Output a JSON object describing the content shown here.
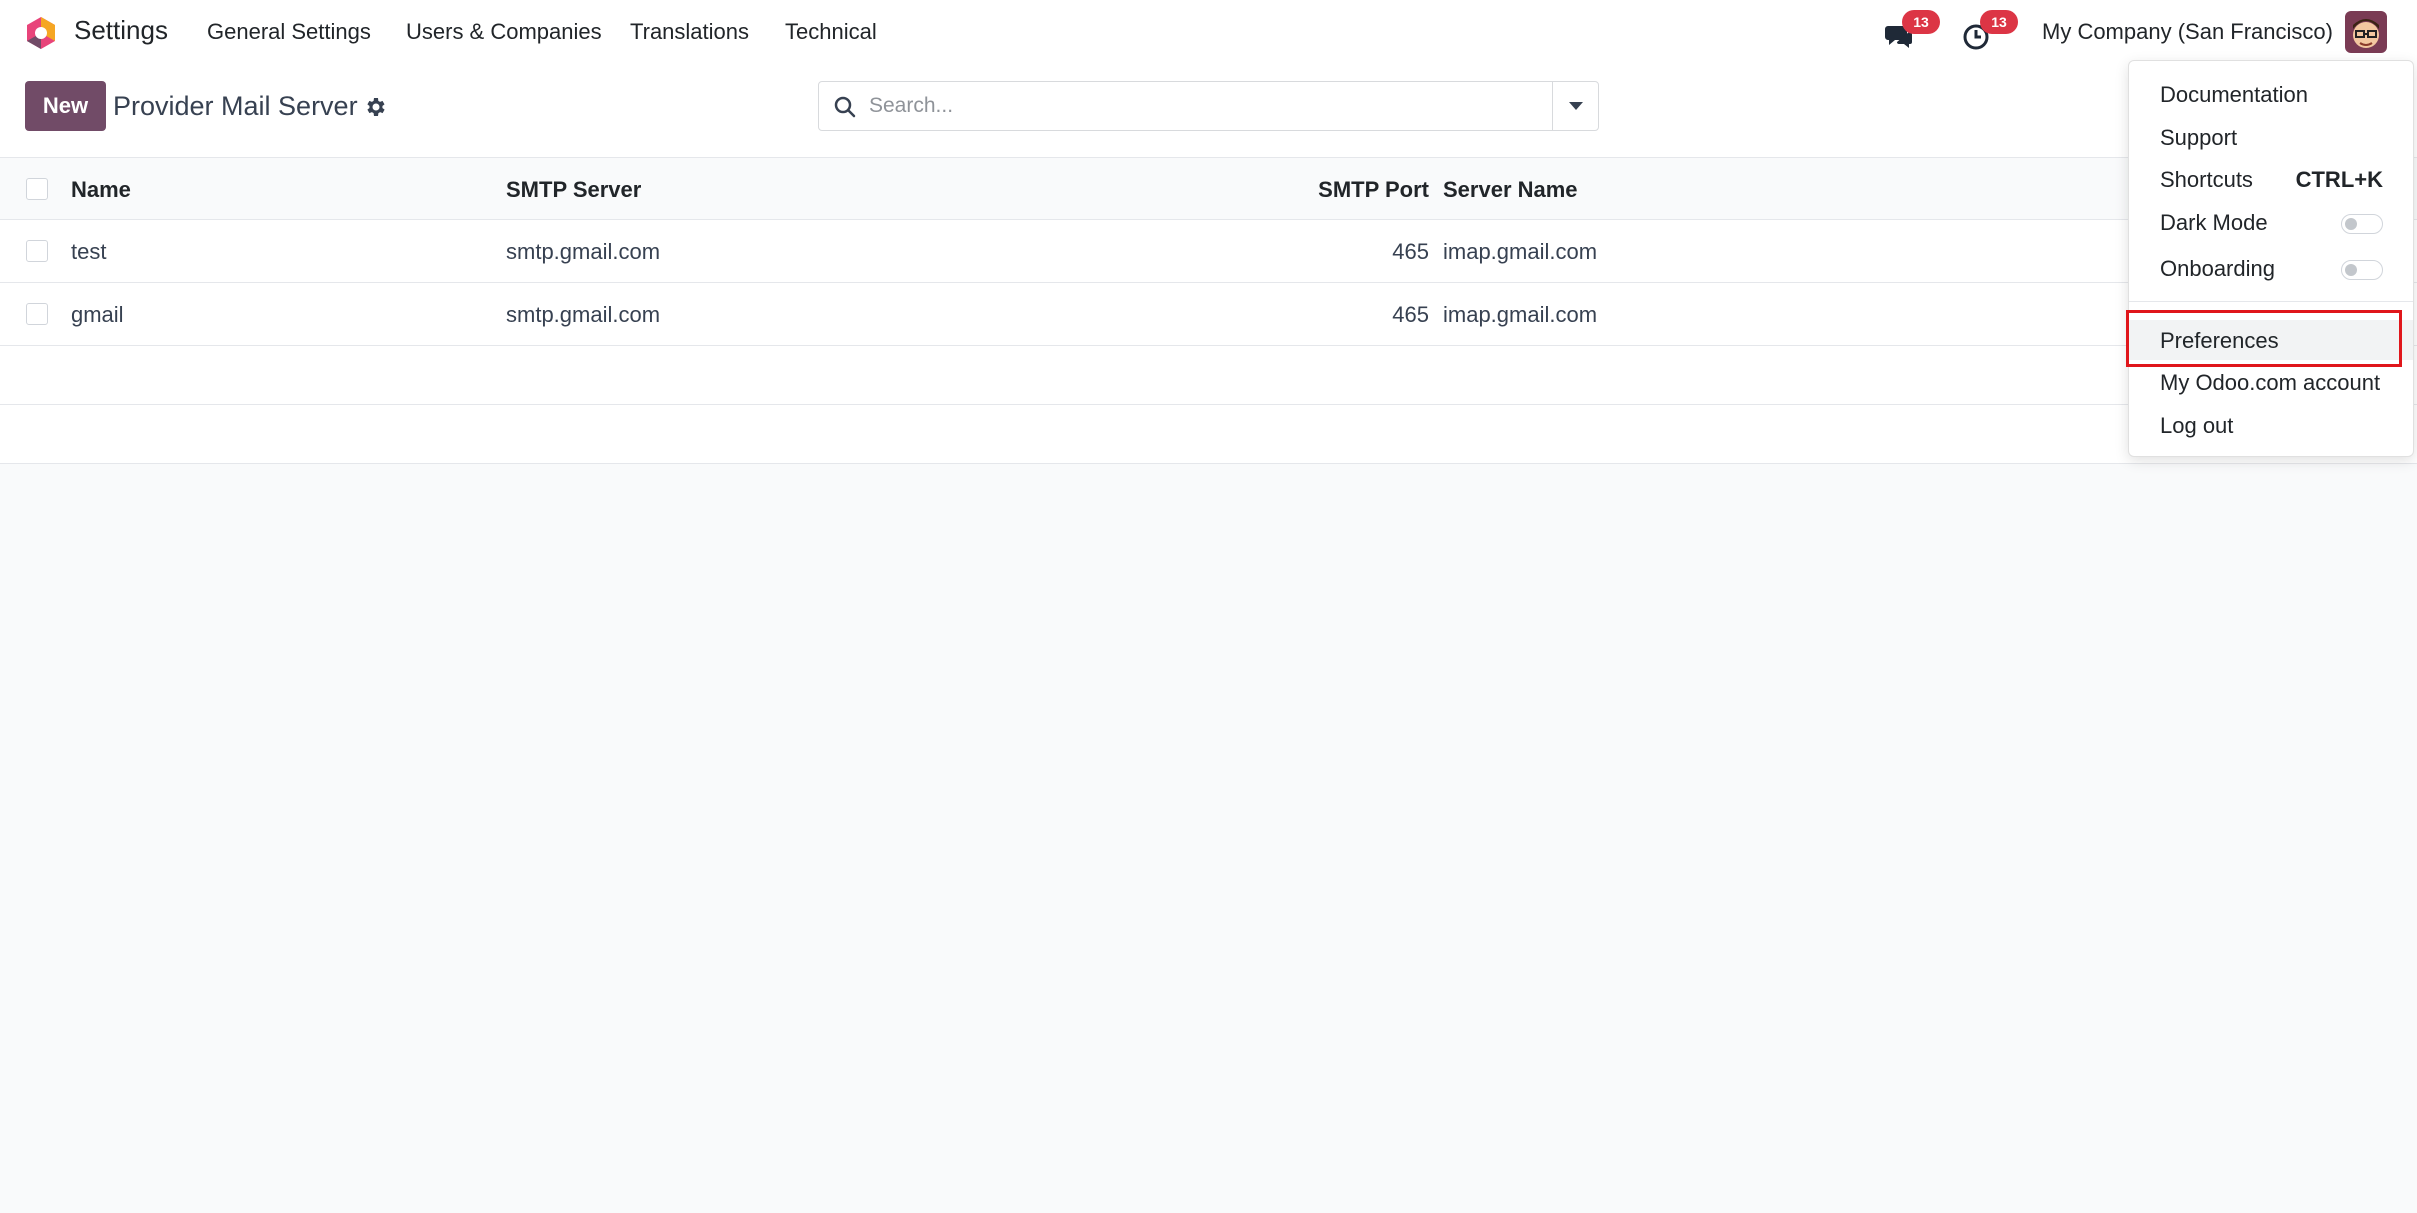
{
  "navbar": {
    "app_name": "Settings",
    "menu": [
      {
        "label": "General Settings"
      },
      {
        "label": "Users & Companies"
      },
      {
        "label": "Translations"
      },
      {
        "label": "Technical"
      }
    ],
    "messages_badge": "13",
    "activities_badge": "13",
    "company": "My Company (San Francisco)"
  },
  "control_panel": {
    "new_label": "New",
    "title": "Provider Mail Server",
    "search_placeholder": "Search..."
  },
  "list": {
    "columns": [
      "Name",
      "SMTP Server",
      "SMTP Port",
      "Server Name"
    ],
    "rows": [
      {
        "name": "test",
        "smtp_server": "smtp.gmail.com",
        "smtp_port": "465",
        "server_name": "imap.gmail.com"
      },
      {
        "name": "gmail",
        "smtp_server": "smtp.gmail.com",
        "smtp_port": "465",
        "server_name": "imap.gmail.com"
      }
    ]
  },
  "user_menu": {
    "documentation": "Documentation",
    "support": "Support",
    "shortcuts": "Shortcuts",
    "shortcuts_key": "CTRL+K",
    "dark_mode": "Dark Mode",
    "onboarding": "Onboarding",
    "preferences": "Preferences",
    "odoo_account": "My Odoo.com account",
    "logout": "Log out"
  },
  "colors": {
    "brand": "#714B67",
    "badge": "#dc3545",
    "highlight": "#e0161b"
  },
  "icons": [
    "odoo-logo-icon",
    "chat-icon",
    "clock-icon",
    "gear-icon",
    "search-icon",
    "caret-down-icon",
    "avatar"
  ]
}
